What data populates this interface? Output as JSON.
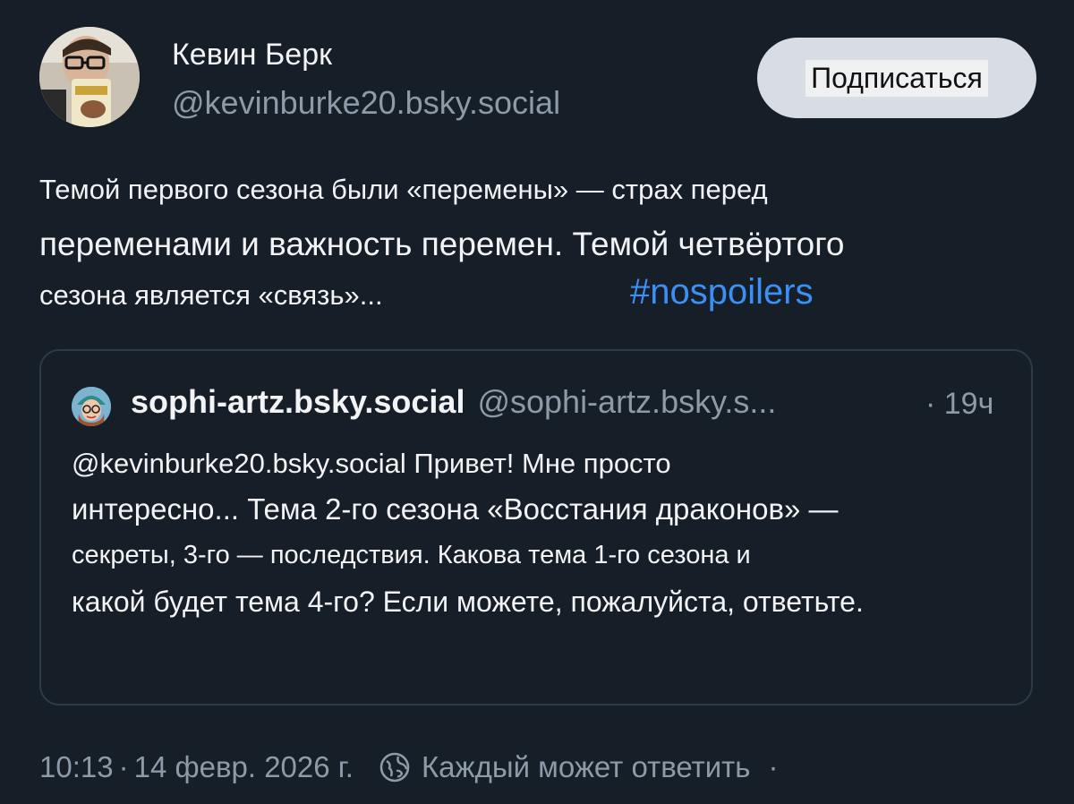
{
  "author": {
    "display_name": "Кевин Берк",
    "handle": "@kevinburke20.bsky.social",
    "avatar_icon": "user-avatar-photo"
  },
  "follow_button": {
    "label": "Подписаться"
  },
  "post": {
    "lines": [
      "Темой первого сезона были «перемены» — страх перед",
      "переменами и важность перемен. Темой четвёртого",
      "сезона является «связь»..."
    ],
    "hashtag": "#nospoilers"
  },
  "quote": {
    "display_name": "sophi-artz.bsky.social",
    "handle": "@sophi-artz.bsky.s...",
    "time": "· 19ч",
    "lines": [
      "@kevinburke20.bsky.social Привет! Мне просто",
      "интересно... Тема 2-го сезона «Восстания драконов» —",
      "секреты, 3-го — последствия. Какова тема 1-го сезона и",
      "какой будет тема 4-го? Если можете, пожалуйста, ответьте."
    ]
  },
  "meta": {
    "time": "10:13",
    "separator": "·",
    "date": "14 февр. 2026 г.",
    "reply_setting": "Каждый может ответить",
    "trailing_dot": "·"
  },
  "colors": {
    "background": "#161e27",
    "text_primary": "#f1f3f5",
    "text_secondary": "#8d9aa8",
    "link": "#3b8ff5",
    "card_border": "#2e3a48",
    "button_bg": "#d8dde3"
  }
}
